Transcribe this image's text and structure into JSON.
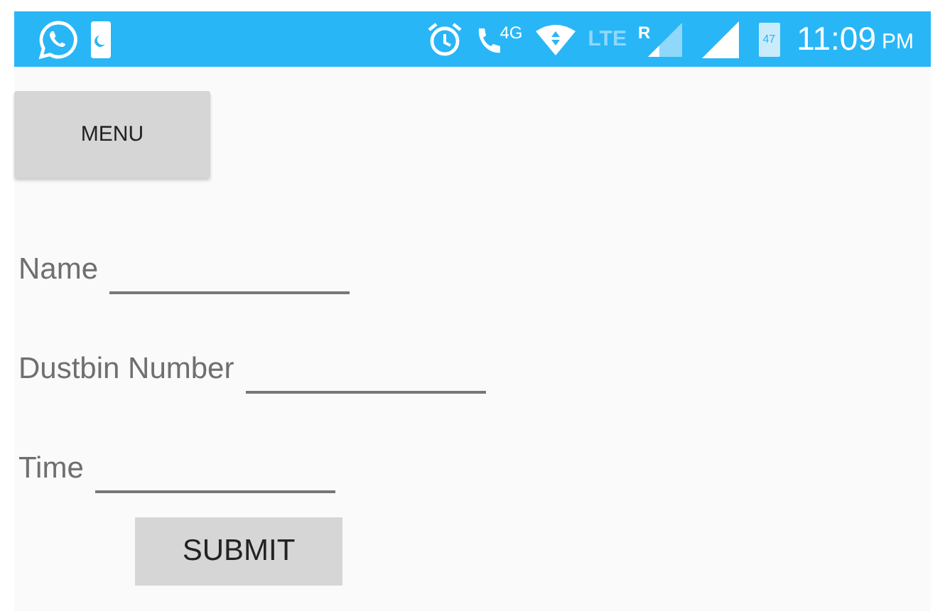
{
  "status_bar": {
    "network": "4G",
    "lte": "LTE",
    "roaming": "R",
    "battery": "47",
    "time": "11:09",
    "ampm": "PM"
  },
  "menu_button": "MENU",
  "fields": [
    {
      "label": "Name"
    },
    {
      "label": "Dustbin Number"
    },
    {
      "label": "Time"
    }
  ],
  "submit_button": "SUBMIT"
}
